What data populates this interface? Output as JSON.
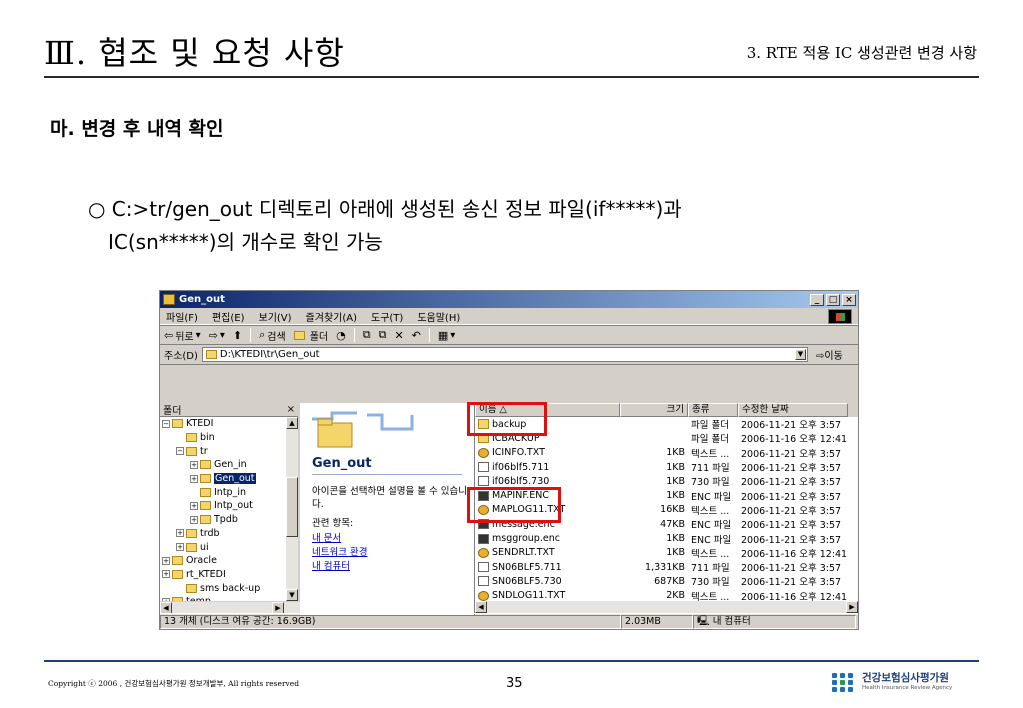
{
  "slide": {
    "title": "Ⅲ. 협조 및 요청 사항",
    "subtitle": "3. RTE 적용 IC 생성관련 변경 사항",
    "section": "마. 변경 후 내역 확인",
    "bullet_line1": "○ C:>tr/gen_out 디렉토리 아래에 생성된 송신 정보 파일(if*****)과",
    "bullet_line2": "IC(sn*****)의 개수로 확인 가능"
  },
  "footer": {
    "copyright": "Copyright ⓒ 2006 , 건강보험심사평가원 정보개발부,  All rights reserved",
    "page_number": "35",
    "logo_kr": "건강보험심사평가원",
    "logo_en": "Health Insurance Review Agency"
  },
  "window": {
    "title": "Gen_out",
    "menu": [
      "파일(F)",
      "편집(E)",
      "보기(V)",
      "즐겨찾기(A)",
      "도구(T)",
      "도움말(H)"
    ],
    "toolbar": {
      "back": "뒤로",
      "search": "검색",
      "folders": "폴더"
    },
    "address_label": "주소(D)",
    "address_value": "D:\\KTEDI\\tr\\Gen_out",
    "go_label": "이동",
    "folder_pane_title": "폴더",
    "tree": [
      {
        "label": "KTEDI",
        "exp": "−"
      },
      {
        "label": "bin",
        "exp": ""
      },
      {
        "label": "tr",
        "exp": "−"
      },
      {
        "label": "Gen_in",
        "exp": "+"
      },
      {
        "label": "Gen_out",
        "exp": "+",
        "selected": true
      },
      {
        "label": "Intp_in",
        "exp": ""
      },
      {
        "label": "Intp_out",
        "exp": "+"
      },
      {
        "label": "Tpdb",
        "exp": "+"
      },
      {
        "label": "trdb",
        "exp": "+"
      },
      {
        "label": "ui",
        "exp": "+"
      },
      {
        "label": "Oracle",
        "exp": "+"
      },
      {
        "label": "rt_KTEDI",
        "exp": "+"
      },
      {
        "label": "sms back-up",
        "exp": ""
      },
      {
        "label": "temp",
        "exp": "+"
      }
    ],
    "info": {
      "title": "Gen_out",
      "description": "아이콘을 선택하면 설명을 볼 수 있습니다.",
      "related": "관련 항목:",
      "links": [
        "내 문서",
        "네트워크 환경",
        "내 컴퓨터"
      ]
    },
    "columns": [
      "이름",
      "크기",
      "종류",
      "수정한 날짜"
    ],
    "files": [
      {
        "name": "backup",
        "size": "",
        "type": "파일 폴더",
        "date": "2006-11-21 오후 3:57",
        "icon": "folder"
      },
      {
        "name": "ICBACKUP",
        "size": "",
        "type": "파일 폴더",
        "date": "2006-11-16 오후 12:41",
        "icon": "folder"
      },
      {
        "name": "ICINFO.TXT",
        "size": "1KB",
        "type": "텍스트 ...",
        "date": "2006-11-21 오후 3:57",
        "icon": "text"
      },
      {
        "name": "if06blf5.711",
        "size": "1KB",
        "type": "711 파일",
        "date": "2006-11-21 오후 3:57",
        "icon": "file"
      },
      {
        "name": "if06blf5.730",
        "size": "1KB",
        "type": "730 파일",
        "date": "2006-11-21 오후 3:57",
        "icon": "file"
      },
      {
        "name": "MAPINF.ENC",
        "size": "1KB",
        "type": "ENC 파일",
        "date": "2006-11-21 오후 3:57",
        "icon": "enc"
      },
      {
        "name": "MAPLOG11.TXT",
        "size": "16KB",
        "type": "텍스트 ...",
        "date": "2006-11-21 오후 3:57",
        "icon": "text"
      },
      {
        "name": "message.enc",
        "size": "47KB",
        "type": "ENC 파일",
        "date": "2006-11-21 오후 3:57",
        "icon": "enc"
      },
      {
        "name": "msggroup.enc",
        "size": "1KB",
        "type": "ENC 파일",
        "date": "2006-11-21 오후 3:57",
        "icon": "enc"
      },
      {
        "name": "SENDRLT.TXT",
        "size": "1KB",
        "type": "텍스트 ...",
        "date": "2006-11-16 오후 12:41",
        "icon": "text"
      },
      {
        "name": "SN06BLF5.711",
        "size": "1,331KB",
        "type": "711 파일",
        "date": "2006-11-21 오후 3:57",
        "icon": "file"
      },
      {
        "name": "SN06BLF5.730",
        "size": "687KB",
        "type": "730 파일",
        "date": "2006-11-21 오후 3:57",
        "icon": "file"
      },
      {
        "name": "SNDLOG11.TXT",
        "size": "2KB",
        "type": "텍스트 ...",
        "date": "2006-11-16 오후 12:41",
        "icon": "text"
      }
    ],
    "status": {
      "objects": "13 개체 (디스크 여유 공간: 16.9GB)",
      "size": "2.03MB",
      "location": "내 컴퓨터"
    }
  },
  "colors": {
    "highlight": "#e01010",
    "titlebar": "#0a246a",
    "footer_rule": "#1d3f7a"
  }
}
